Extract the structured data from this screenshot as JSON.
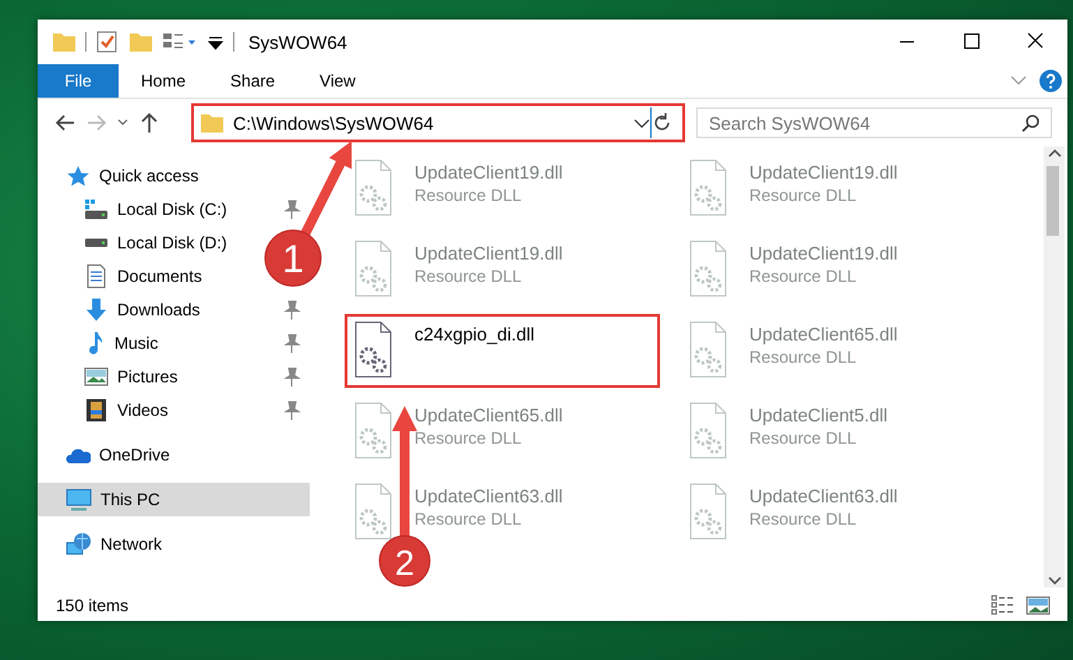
{
  "window": {
    "title": "SysWOW64"
  },
  "ribbon_tabs": [
    {
      "label": "File",
      "kind": "file-menu"
    },
    {
      "label": "Home",
      "kind": "tab"
    },
    {
      "label": "Share",
      "kind": "tab"
    },
    {
      "label": "View",
      "kind": "tab"
    }
  ],
  "address": {
    "path": "C:\\Windows\\SysWOW64",
    "highlighted": true
  },
  "search": {
    "placeholder": "Search SysWOW64"
  },
  "nav": [
    {
      "label": "Quick access",
      "kind": "quick-access",
      "pinned": false,
      "selected": false,
      "children": [
        {
          "label": "Local Disk (C:)",
          "kind": "system-drive",
          "pinned": true,
          "selected": false
        },
        {
          "label": "Local Disk (D:)",
          "kind": "drive",
          "pinned": false,
          "selected": false
        },
        {
          "label": "Documents",
          "kind": "documents",
          "pinned": false,
          "selected": false
        },
        {
          "label": "Downloads",
          "kind": "downloads",
          "pinned": true,
          "selected": false
        },
        {
          "label": "Music",
          "kind": "music",
          "pinned": true,
          "selected": false
        },
        {
          "label": "Pictures",
          "kind": "pictures",
          "pinned": true,
          "selected": false
        },
        {
          "label": "Videos",
          "kind": "videos",
          "pinned": true,
          "selected": false
        }
      ]
    },
    {
      "label": "OneDrive",
      "kind": "cloud",
      "pinned": false,
      "selected": false
    },
    {
      "label": "This PC",
      "kind": "pc",
      "pinned": false,
      "selected": true
    },
    {
      "label": "Network",
      "kind": "network",
      "pinned": false,
      "selected": false
    }
  ],
  "files": [
    {
      "name": "UpdateClient19.dll",
      "type": "Resource DLL",
      "faded": true,
      "highlighted": false
    },
    {
      "name": "UpdateClient19.dll",
      "type": "Resource DLL",
      "faded": true,
      "highlighted": false
    },
    {
      "name": "UpdateClient19.dll",
      "type": "Resource DLL",
      "faded": true,
      "highlighted": false
    },
    {
      "name": "UpdateClient19.dll",
      "type": "Resource DLL",
      "faded": true,
      "highlighted": false
    },
    {
      "name": "c24xgpio_di.dll",
      "faded": false,
      "highlighted": true
    },
    {
      "name": "UpdateClient65.dll",
      "type": "Resource DLL",
      "faded": true,
      "highlighted": false
    },
    {
      "name": "UpdateClient65.dll",
      "type": "Resource DLL",
      "faded": true,
      "highlighted": false
    },
    {
      "name": "UpdateClient5.dll",
      "type": "Resource DLL",
      "faded": true,
      "highlighted": false
    },
    {
      "name": "UpdateClient63.dll",
      "type": "Resource DLL",
      "faded": true,
      "highlighted": false
    },
    {
      "name": "UpdateClient63.dll",
      "type": "Resource DLL",
      "faded": true,
      "highlighted": false
    }
  ],
  "status_bar": {
    "item_count": "150 items"
  },
  "callouts": [
    {
      "number": "1"
    },
    {
      "number": "2"
    }
  ]
}
